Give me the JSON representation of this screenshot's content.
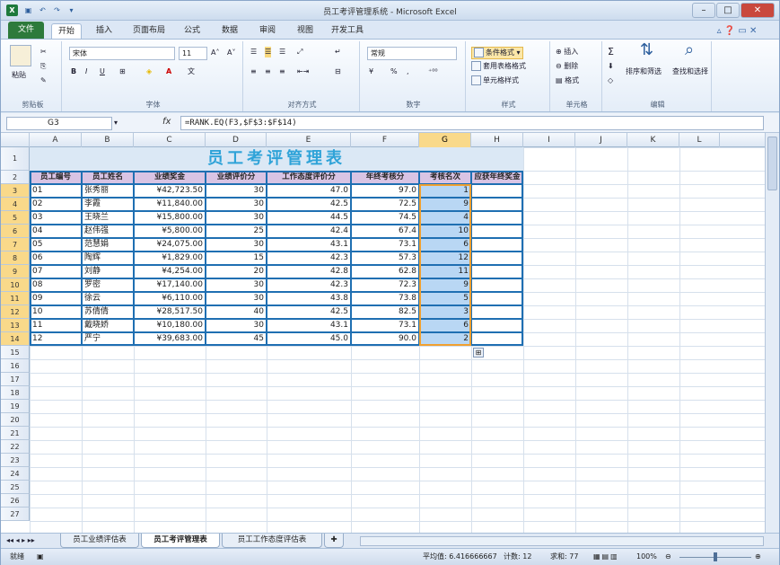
{
  "window": {
    "title": "员工考评管理系统 - Microsoft Excel"
  },
  "quick_access": {
    "app_icon": "X",
    "save_icon": "save-icon",
    "undo_icon": "undo-icon",
    "redo_icon": "redo-icon"
  },
  "tabs": [
    {
      "label": "文件"
    },
    {
      "label": "开始"
    },
    {
      "label": "插入"
    },
    {
      "label": "页面布局"
    },
    {
      "label": "公式"
    },
    {
      "label": "数据"
    },
    {
      "label": "审阅"
    },
    {
      "label": "视图"
    },
    {
      "label": "开发工具"
    }
  ],
  "ribbon": {
    "clipboard": {
      "label": "剪贴板",
      "paste": "粘贴"
    },
    "font": {
      "label": "字体",
      "name": "宋体",
      "size": "11",
      "bold": "B",
      "italic": "I",
      "underline": "U",
      "grow": "A˄",
      "shrink": "A˅"
    },
    "alignment": {
      "label": "对齐方式"
    },
    "number": {
      "label": "数字",
      "format": "常规",
      "currency": "%",
      "comma": ","
    },
    "styles": {
      "label": "样式",
      "conditional": "条件格式",
      "table": "套用表格格式",
      "cell": "单元格样式"
    },
    "cells": {
      "label": "单元格",
      "insert": "插入",
      "delete": "删除",
      "format": "格式"
    },
    "editing": {
      "label": "编辑",
      "sort": "排序和筛选",
      "find": "查找和选择"
    }
  },
  "formula_bar": {
    "name_box": "G3",
    "fx": "fx",
    "formula": "=RANK.EQ(F3,$F$3:$F$14)"
  },
  "columns": [
    "A",
    "B",
    "C",
    "D",
    "E",
    "F",
    "G",
    "H",
    "I",
    "J",
    "K",
    "L"
  ],
  "rows": [
    "1",
    "2",
    "3",
    "4",
    "5",
    "6",
    "7",
    "8",
    "9",
    "10",
    "11",
    "12",
    "13",
    "14",
    "15",
    "16",
    "17",
    "18",
    "19",
    "20",
    "21",
    "22",
    "23",
    "24",
    "25",
    "26",
    "27"
  ],
  "sheet": {
    "title": "员工考评管理表",
    "headers": [
      "员工编号",
      "员工姓名",
      "业绩奖金",
      "业绩评价分",
      "工作态度评价分",
      "年终考核分",
      "考核名次",
      "应获年终奖金"
    ],
    "data": [
      [
        "01",
        "张秀丽",
        "¥42,723.50",
        "30",
        "47.0",
        "97.0",
        "1",
        ""
      ],
      [
        "02",
        "李霞",
        "¥11,840.00",
        "30",
        "42.5",
        "72.5",
        "9",
        ""
      ],
      [
        "03",
        "王晓兰",
        "¥15,800.00",
        "30",
        "44.5",
        "74.5",
        "4",
        ""
      ],
      [
        "04",
        "赵伟强",
        "¥5,800.00",
        "25",
        "42.4",
        "67.4",
        "10",
        ""
      ],
      [
        "05",
        "范慧娟",
        "¥24,075.00",
        "30",
        "43.1",
        "73.1",
        "6",
        ""
      ],
      [
        "06",
        "陶辉",
        "¥1,829.00",
        "15",
        "42.3",
        "57.3",
        "12",
        ""
      ],
      [
        "07",
        "刘静",
        "¥4,254.00",
        "20",
        "42.8",
        "62.8",
        "11",
        ""
      ],
      [
        "08",
        "罗密",
        "¥17,140.00",
        "30",
        "42.3",
        "72.3",
        "9",
        ""
      ],
      [
        "09",
        "徐云",
        "¥6,110.00",
        "30",
        "43.8",
        "73.8",
        "5",
        ""
      ],
      [
        "10",
        "苏倩倩",
        "¥28,517.50",
        "40",
        "42.5",
        "82.5",
        "3",
        ""
      ],
      [
        "11",
        "戴晓娇",
        "¥10,180.00",
        "30",
        "43.1",
        "73.1",
        "6",
        ""
      ],
      [
        "12",
        "严宁",
        "¥39,683.00",
        "45",
        "45.0",
        "90.0",
        "2",
        ""
      ]
    ]
  },
  "sheet_tabs": [
    {
      "label": "员工业绩评估表"
    },
    {
      "label": "员工考评管理表"
    },
    {
      "label": "员工工作态度评估表"
    }
  ],
  "status": {
    "mode": "就绪",
    "average": "平均值: 6.416666667",
    "count": "计数: 12",
    "sum": "求和: 77",
    "zoom": "100%"
  },
  "colors": {
    "accent": "#2d7a3b",
    "header_fill": "#d9c4e4",
    "title_fill": "#dbe8f5",
    "title_text": "#2fa3d8",
    "selection": "#b9d7f4"
  }
}
